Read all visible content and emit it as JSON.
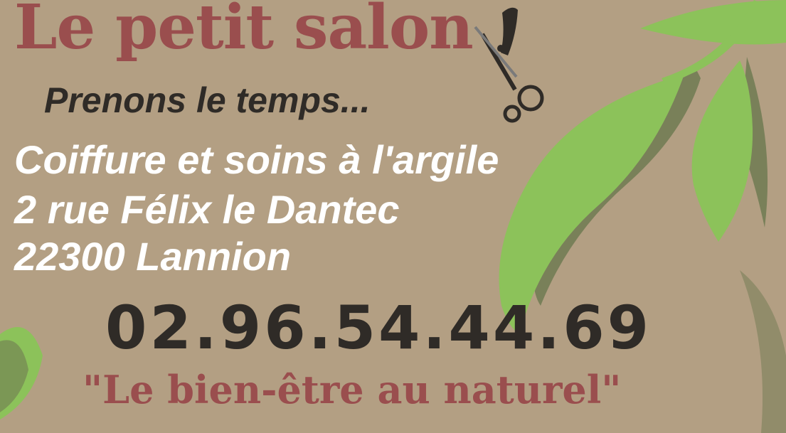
{
  "card": {
    "title": "Le petit salon",
    "tagline": "Prenons le temps...",
    "service": "Coiffure et soins à l'argile",
    "street": "2 rue Félix le Dantec",
    "city": "22300 Lannion",
    "phone": "02.96.54.44.69",
    "slogan": "\"Le bien-être au naturel\""
  },
  "colors": {
    "background": "#b39f83",
    "title": "#9a4e4e",
    "dark_text": "#2f2b27",
    "white_text": "#ffffff",
    "leaf_light": "#8cc25a",
    "leaf_shadow": "#6f7a52"
  },
  "icons": {
    "scissors": "scissors-comb-icon",
    "leaves": "green-leaves-decoration"
  }
}
